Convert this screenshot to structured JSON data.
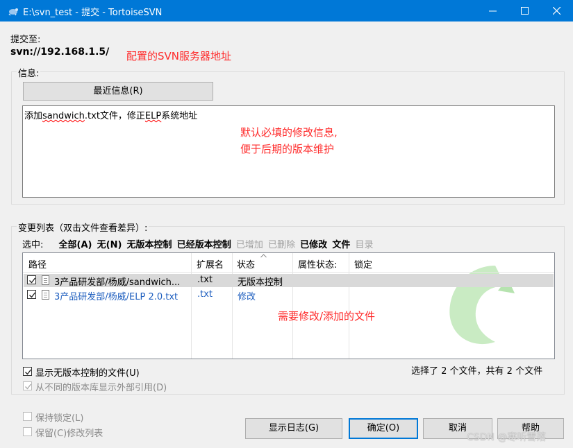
{
  "window": {
    "title": "E:\\svn_test - 提交 - TortoiseSVN",
    "accent": "#0078d7"
  },
  "commit_to": {
    "label": "提交至:",
    "url": "svn://192.168.1.5/",
    "annotation": "配置的SVN服务器地址"
  },
  "message": {
    "group_label": "信息:",
    "recent_button": "最近信息(R)",
    "text_prefix": "添加",
    "text_spell1": "sandwich",
    "text_mid": ".txt文件，修正",
    "text_spell2": "ELP",
    "text_suffix": "系统地址",
    "annotation_line1": "默认必填的修改信息,",
    "annotation_line2": "便于后期的版本维护"
  },
  "changes": {
    "group_label": "变更列表（双击文件查看差异）:",
    "select_label": "选中:",
    "filters": [
      {
        "label": "全部(A)",
        "state": "bold"
      },
      {
        "label": "无(N)",
        "state": "bold"
      },
      {
        "label": "无版本控制",
        "state": "bold"
      },
      {
        "label": "已经版本控制",
        "state": "bold"
      },
      {
        "label": "已增加",
        "state": "gray"
      },
      {
        "label": "已删除",
        "state": "gray"
      },
      {
        "label": "已修改",
        "state": "bold"
      },
      {
        "label": "文件",
        "state": "bold"
      },
      {
        "label": "目录",
        "state": "gray"
      }
    ],
    "columns": [
      "路径",
      "扩展名",
      "状态",
      "属性状态:",
      "锁定"
    ],
    "rows": [
      {
        "path": "3产品研发部/杨威/sandwich...",
        "ext": ".txt",
        "status": "无版本控制",
        "checked": true
      },
      {
        "path": "3产品研发部/杨威/ELP 2.0.txt",
        "ext": ".txt",
        "status": "修改",
        "checked": true
      }
    ],
    "annotation": "需要修改/添加的文件",
    "summary": "选择了 2 个文件，共有 2 个文件"
  },
  "options": {
    "show_unversioned": "显示无版本控制的文件(U)",
    "show_externals": "从不同的版本库显示外部引用(D)",
    "keep_locks": "保持锁定(L)",
    "keep_changelists": "保留(C)修改列表"
  },
  "buttons": {
    "show_log": "显示日志(G)",
    "ok": "确定(O)",
    "cancel": "取消",
    "help": "帮助"
  },
  "watermark": "CSDN @寒听雪落",
  "colors": {
    "annotation": "#ff2a2a",
    "link_blue": "#1f5fbf"
  }
}
